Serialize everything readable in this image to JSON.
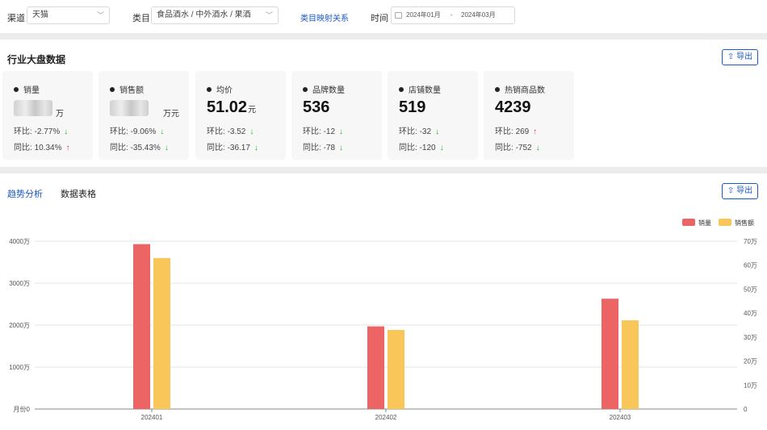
{
  "filters": {
    "channel_label": "渠道",
    "channel_value": "天猫",
    "category_label": "类目",
    "category_value": "食品酒水 / 中外酒水 / 果酒",
    "mapping_link": "类目映射关系",
    "time_label": "时间",
    "date_start": "2024年01月",
    "date_sep": "-",
    "date_end": "2024年03月"
  },
  "overview": {
    "title": "行业大盘数据",
    "export_label": "导出",
    "cards": [
      {
        "title": "销量",
        "value": "",
        "unit": "万",
        "mom_label": "环比:",
        "mom": "-2.77%",
        "mom_dir": "down",
        "yoy_label": "同比:",
        "yoy": "10.34%",
        "yoy_dir": "up"
      },
      {
        "title": "销售额",
        "value": "",
        "unit": "万元",
        "mom_label": "环比:",
        "mom": "-9.06%",
        "mom_dir": "down",
        "yoy_label": "同比:",
        "yoy": "-35.43%",
        "yoy_dir": "down"
      },
      {
        "title": "均价",
        "value": "51.02",
        "unit": "元",
        "mom_label": "环比:",
        "mom": "-3.52",
        "mom_dir": "down",
        "yoy_label": "同比:",
        "yoy": "-36.17",
        "yoy_dir": "down"
      },
      {
        "title": "品牌数量",
        "value": "536",
        "unit": "",
        "mom_label": "环比:",
        "mom": "-12",
        "mom_dir": "down",
        "yoy_label": "同比:",
        "yoy": "-78",
        "yoy_dir": "down"
      },
      {
        "title": "店铺数量",
        "value": "519",
        "unit": "",
        "mom_label": "环比:",
        "mom": "-32",
        "mom_dir": "down",
        "yoy_label": "同比:",
        "yoy": "-120",
        "yoy_dir": "down"
      },
      {
        "title": "热销商品数",
        "value": "4239",
        "unit": "",
        "mom_label": "环比:",
        "mom": "269",
        "mom_dir": "up",
        "yoy_label": "同比:",
        "yoy": "-752",
        "yoy_dir": "down"
      }
    ]
  },
  "trend": {
    "tabs": [
      "趋势分析",
      "数据表格"
    ],
    "active_tab": 0,
    "export_label": "导出"
  },
  "icons": {
    "arrow_down": "↓",
    "arrow_up": "↑",
    "export": "⇧",
    "chevron": "﹀"
  },
  "colors": {
    "accent": "#1a57c9",
    "series_sales_volume": "#ec6464",
    "series_sales_amount": "#f9c659",
    "up": "#e83b3b",
    "down": "#1fb33a"
  },
  "chart_data": {
    "type": "bar",
    "categories": [
      "202401",
      "202402",
      "202403"
    ],
    "series": [
      {
        "name": "销量",
        "axis": "left",
        "values": [
          3930,
          1970,
          2630
        ]
      },
      {
        "name": "销售额",
        "axis": "right",
        "values": [
          63,
          33,
          37
        ]
      }
    ],
    "y_left": {
      "ticks": [
        "0",
        "1000万",
        "2000万",
        "3000万",
        "4000万"
      ],
      "tick_values": [
        0,
        1000,
        2000,
        3000,
        4000
      ],
      "ylim": [
        0,
        4000
      ],
      "label": "月份"
    },
    "y_right": {
      "ticks": [
        "0",
        "10万",
        "20万",
        "30万",
        "40万",
        "50万",
        "60万",
        "70万"
      ],
      "tick_values": [
        0,
        10,
        20,
        30,
        40,
        50,
        60,
        70
      ],
      "ylim": [
        0,
        70
      ]
    },
    "grid": true,
    "legend": "top-right"
  }
}
